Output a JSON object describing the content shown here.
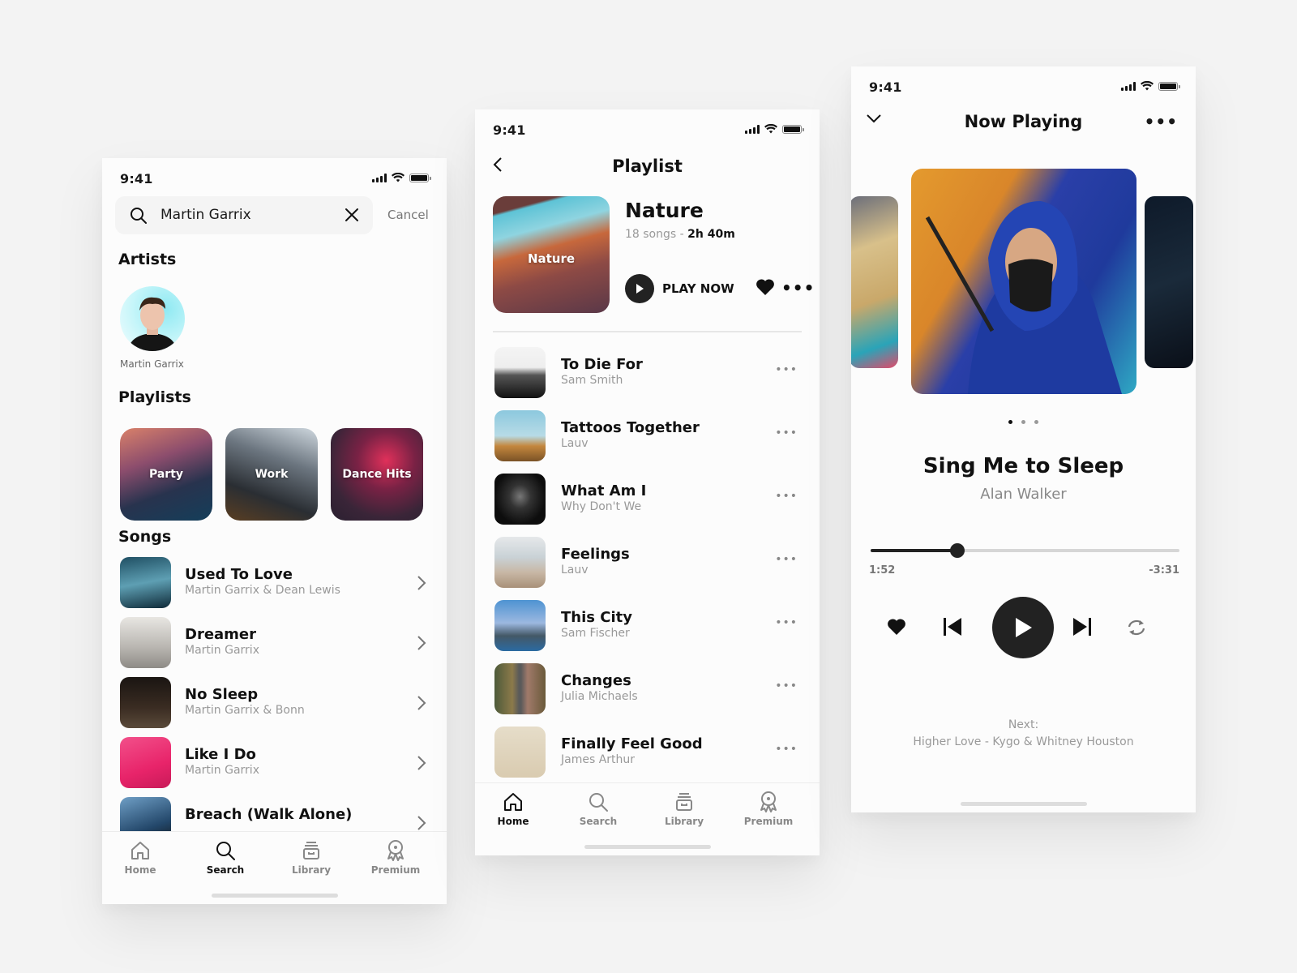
{
  "status_bar": {
    "time": "9:41"
  },
  "search_screen": {
    "search": {
      "value": "Martin Garrix",
      "cancel_label": "Cancel"
    },
    "artists_heading": "Artists",
    "artists": [
      {
        "name": "Martin Garrix"
      }
    ],
    "playlists_heading": "Playlists",
    "playlists": [
      {
        "label": "Party"
      },
      {
        "label": "Work"
      },
      {
        "label": "Dance Hits"
      }
    ],
    "songs_heading": "Songs",
    "songs": [
      {
        "title": "Used To Love",
        "artist": "Martin Garrix & Dean Lewis"
      },
      {
        "title": "Dreamer",
        "artist": "Martin Garrix"
      },
      {
        "title": "No Sleep",
        "artist": "Martin Garrix & Bonn"
      },
      {
        "title": "Like I Do",
        "artist": "Martin Garrix"
      },
      {
        "title": "Breach (Walk Alone)",
        "artist": ""
      }
    ],
    "tabs": [
      {
        "label": "Home",
        "icon": "home-icon"
      },
      {
        "label": "Search",
        "icon": "search-icon",
        "active": true
      },
      {
        "label": "Library",
        "icon": "library-icon"
      },
      {
        "label": "Premium",
        "icon": "premium-badge-icon"
      }
    ]
  },
  "playlist_screen": {
    "title": "Playlist",
    "playlist": {
      "name": "Nature",
      "cover_label": "Nature",
      "songs_count": "18 songs",
      "separator": " - ",
      "duration": "2h 40m"
    },
    "play_now_label": "PLAY NOW",
    "more_label": "•••",
    "tracks": [
      {
        "title": "To Die For",
        "artist": "Sam Smith"
      },
      {
        "title": "Tattoos Together",
        "artist": "Lauv"
      },
      {
        "title": "What Am I",
        "artist": "Why Don't We"
      },
      {
        "title": "Feelings",
        "artist": "Lauv"
      },
      {
        "title": "This City",
        "artist": "Sam Fischer"
      },
      {
        "title": "Changes",
        "artist": "Julia Michaels"
      },
      {
        "title": "Finally Feel Good",
        "artist": "James Arthur"
      }
    ],
    "track_more_label": "•••",
    "tabs": [
      {
        "label": "Home",
        "icon": "home-icon",
        "active": true
      },
      {
        "label": "Search",
        "icon": "search-icon"
      },
      {
        "label": "Library",
        "icon": "library-icon"
      },
      {
        "label": "Premium",
        "icon": "premium-badge-icon"
      }
    ]
  },
  "now_playing_screen": {
    "title": "Now Playing",
    "more_label": "•••",
    "song_title": "Sing Me to Sleep",
    "artist": "Alan Walker",
    "carousel": {
      "count": 3,
      "active_index": 0
    },
    "progress": {
      "elapsed": "1:52",
      "remaining": "-3:31",
      "fraction": 0.28
    },
    "next_label": "Next:",
    "next_value": "Higher Love - Kygo & Whitney Houston"
  }
}
